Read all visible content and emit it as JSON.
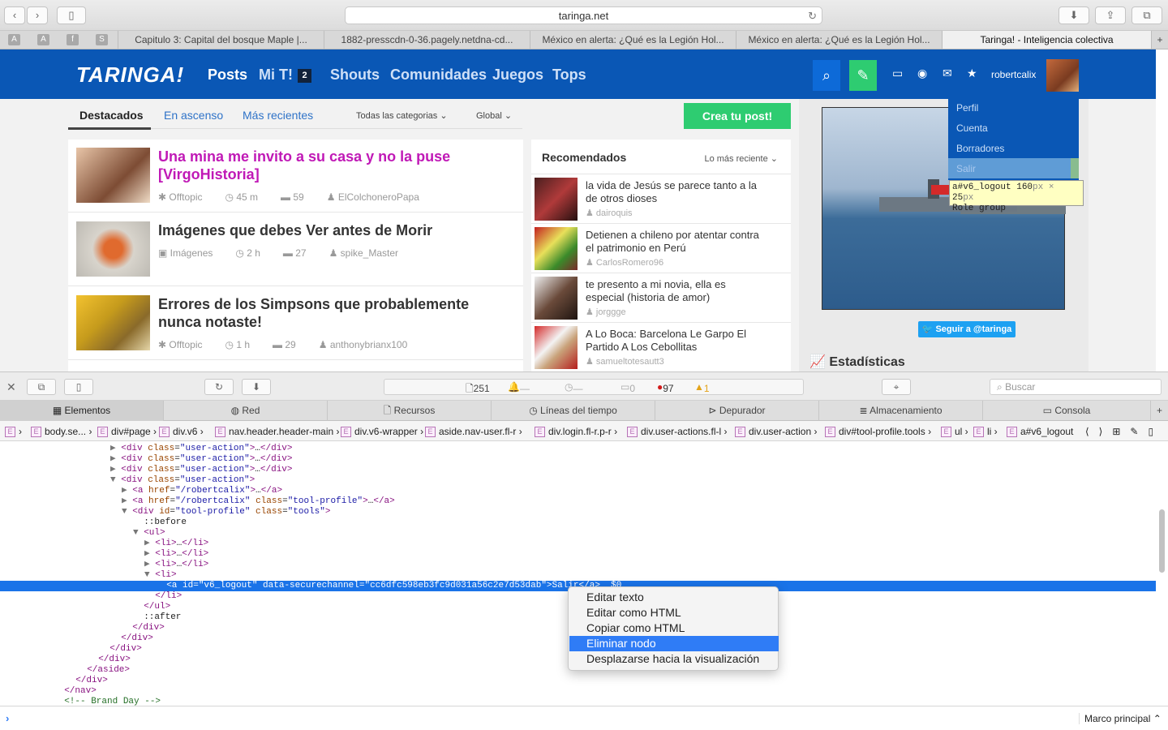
{
  "browser": {
    "url": "taringa.net",
    "tabs": [
      "Capitulo 3: Capital del bosque Maple |...",
      "1882-presscdn-0-36.pagely.netdna-cd...",
      "México en alerta: ¿Qué es la Legión Hol...",
      "México en alerta: ¿Qué es la Legión Hol...",
      "Taringa! - Inteligencia colectiva"
    ],
    "favicons": [
      "A",
      "A",
      "S"
    ]
  },
  "site": {
    "logo": "TARINGA!",
    "nav": [
      "Posts",
      "Mi T!",
      "Shouts",
      "Comunidades",
      "Juegos",
      "Tops"
    ],
    "mit_badge": "2",
    "username": "robertcalix",
    "user_menu": [
      "Perfil",
      "Cuenta",
      "Borradores",
      "Salir"
    ]
  },
  "tooltip": {
    "selector": "a#v6_logout",
    "width": "160",
    "height": "25",
    "role_label": "Role",
    "role": "group"
  },
  "feed": {
    "tabs": [
      "Destacados",
      "En ascenso",
      "Más recientes"
    ],
    "category": "Todas las categorias",
    "scope": "Global",
    "create_button": "Crea tu post!",
    "posts": [
      {
        "title": "Una mina me invito a su casa y no la puse [VirgoHistoria]",
        "category": "Offtopic",
        "time": "45 m",
        "comments": "59",
        "author": "ElColchoneroPapa"
      },
      {
        "title": "Imágenes que debes Ver antes de Morir",
        "category": "Imágenes",
        "time": "2 h",
        "comments": "27",
        "author": "spike_Master"
      },
      {
        "title": "Errores de los Simpsons que probablemente nunca notaste!",
        "category": "Offtopic",
        "time": "1 h",
        "comments": "29",
        "author": "anthonybrianx100"
      }
    ]
  },
  "recommended": {
    "title": "Recomendados",
    "sort": "Lo más reciente",
    "items": [
      {
        "title": "la vida de Jesús se parece tanto a la de otros dioses",
        "author": "dairoquis"
      },
      {
        "title": "Detienen a chileno por atentar contra el patrimonio en Perú",
        "author": "CarlosRomero96"
      },
      {
        "title": "te presento a mi novia, ella es especial (historia de amor)",
        "author": "jorggge"
      },
      {
        "title": "A Lo Boca: Barcelona Le Garpo El Partido A Los Cebollitas",
        "author": "samueltotesautt3"
      }
    ]
  },
  "sidebar": {
    "follow": "Seguir a @taringa",
    "stats": "Estadísticas"
  },
  "inspector": {
    "activity": {
      "resources": "251",
      "errors": "97",
      "warnings": "1",
      "logs": "0",
      "dash1": "—",
      "dash2": "—"
    },
    "search_placeholder": "Buscar",
    "tabs": [
      "Elementos",
      "Red",
      "Recursos",
      "Líneas del tiempo",
      "Depurador",
      "Almacenamiento",
      "Consola"
    ],
    "breadcrumbs": [
      "body.se...",
      "div#page",
      "div.v6",
      "nav.header.header-main",
      "div.v6-wrapper",
      "aside.nav-user.fl-r",
      "div.login.fl-r.p-r",
      "div.user-actions.fl-l",
      "div.user-action",
      "div#tool-profile.tools",
      "ul",
      "li",
      "a#v6_logout"
    ],
    "dom": [
      {
        "i": 0,
        "tw": "▶ ",
        "html": "<div class=\"user-action\">…</div>"
      },
      {
        "i": 0,
        "tw": "▶ ",
        "html": "<div class=\"user-action\">…</div>"
      },
      {
        "i": 0,
        "tw": "▶ ",
        "html": "<div class=\"user-action\">…</div>"
      },
      {
        "i": 0,
        "tw": "▼ ",
        "html": "<div class=\"user-action\">"
      },
      {
        "i": 1,
        "tw": "▶ ",
        "html": "<a href=\"/robertcalix\">…</a>"
      },
      {
        "i": 1,
        "tw": "▶ ",
        "html": "<a href=\"/robertcalix\" class=\"tool-profile\">…</a>"
      },
      {
        "i": 1,
        "tw": "▼ ",
        "html": "<div id=\"tool-profile\" class=\"tools\">"
      },
      {
        "i": 2,
        "tw": "  ",
        "html": "::before"
      },
      {
        "i": 2,
        "tw": "▼ ",
        "html": "<ul>"
      },
      {
        "i": 3,
        "tw": "▶ ",
        "html": "<li>…</li>"
      },
      {
        "i": 3,
        "tw": "▶ ",
        "html": "<li>…</li>"
      },
      {
        "i": 3,
        "tw": "▶ ",
        "html": "<li>…</li>"
      },
      {
        "i": 3,
        "tw": "▼ ",
        "html": "<li>"
      },
      {
        "i": 4,
        "tw": "  ",
        "html": "<a id=\"v6_logout\" data-securechannel=\"cc6dfc598eb3fc9d031a56c2e7d53dab\">Salir</a> = $0"
      },
      {
        "i": 3,
        "tw": "  ",
        "html": "</li>"
      },
      {
        "i": 2,
        "tw": "  ",
        "html": "</ul>"
      },
      {
        "i": 2,
        "tw": "  ",
        "html": "::after"
      },
      {
        "i": 1,
        "tw": "  ",
        "html": "</div>"
      },
      {
        "i": 0,
        "tw": "  ",
        "html": "</div>"
      },
      {
        "i": -1,
        "tw": "  ",
        "html": "</div>"
      },
      {
        "i": -2,
        "tw": "  ",
        "html": "</div>"
      },
      {
        "i": -3,
        "tw": "  ",
        "html": "</aside>"
      },
      {
        "i": -4,
        "tw": "  ",
        "html": "</div>"
      },
      {
        "i": -5,
        "tw": "  ",
        "html": "</nav>"
      },
      {
        "i": -5,
        "tw": "  ",
        "html": "<!-- Brand Day -->"
      }
    ],
    "selected_line": 13,
    "context_menu": [
      "Editar texto",
      "Editar como HTML",
      "Copiar como HTML",
      "Eliminar nodo",
      "Desplazarse hacia la visualización"
    ],
    "context_active": 3,
    "frame": "Marco principal"
  },
  "colors": {
    "brand": "#0a57b5",
    "accent": "#2ecc71",
    "hot": "#c019b6",
    "selection": "#1a73e8"
  }
}
